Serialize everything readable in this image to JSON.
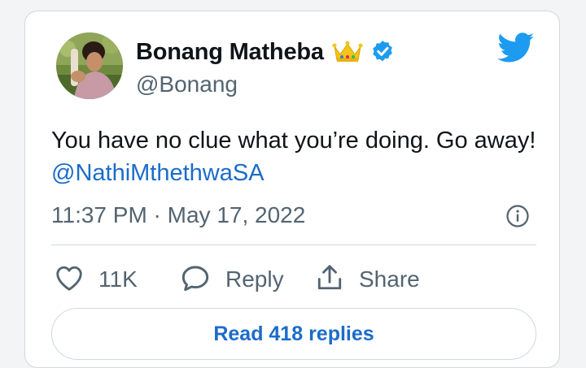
{
  "tweet": {
    "author": {
      "display_name": "Bonang Matheba",
      "handle": "@Bonang"
    },
    "text": "You have no clue what you’re doing. Go away!",
    "mention": "@NathiMthethwaSA",
    "timestamp": "11:37 PM · May 17, 2022"
  },
  "actions": {
    "like_count": "11K",
    "reply_label": "Reply",
    "share_label": "Share"
  },
  "read_replies_label": "Read 418 replies",
  "icons": {
    "crown": "crown-emoji-icon",
    "verified": "verified-badge-icon",
    "logo": "twitter-bird-icon",
    "info": "info-icon",
    "like": "heart-icon",
    "reply": "speech-bubble-icon",
    "share": "share-upload-icon"
  },
  "colors": {
    "brand_blue": "#1d9bf0",
    "link_blue": "#1b6cc9",
    "text_primary": "#0f1419",
    "text_secondary": "#536471",
    "border": "#cfd9de"
  }
}
